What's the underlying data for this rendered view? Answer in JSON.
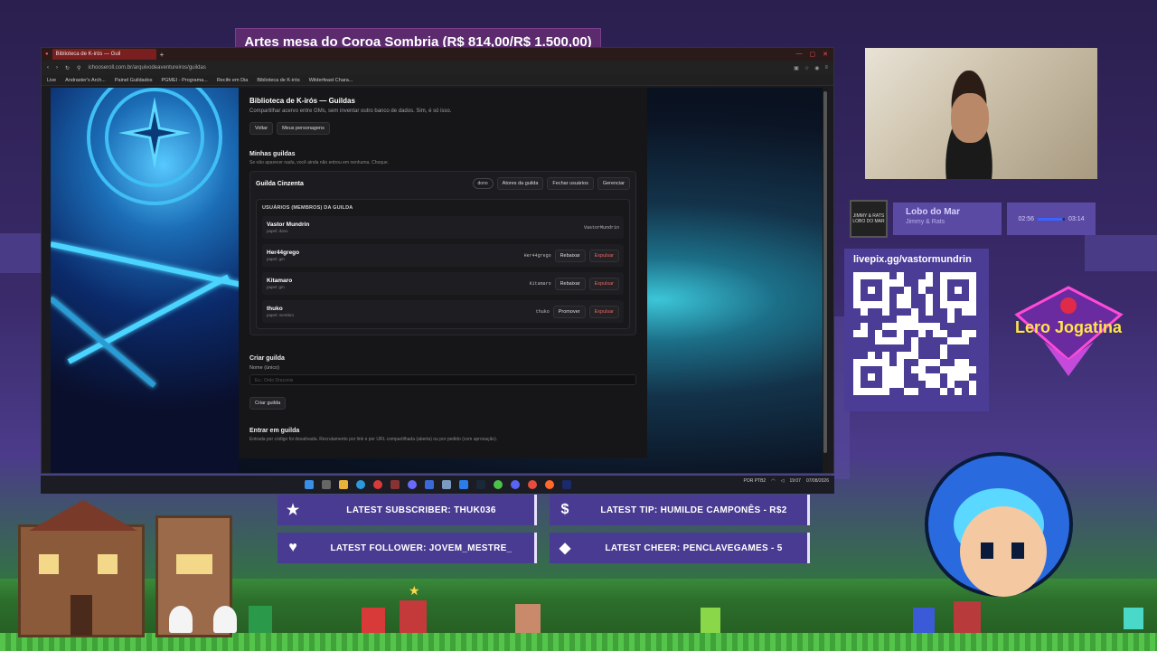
{
  "overlay": {
    "banner_title": "Artes mesa do Coroa Sombria (R$ 814,00/R$ 1.500,00)",
    "music": {
      "album_label": "JIMMY & RATS LOBO DO MAR",
      "title": "Lobo do Mar",
      "artist": "Jimmy & Rats",
      "elapsed": "02:56",
      "total": "03:14",
      "progress": 0.91
    },
    "pix_label": "livepix.gg/vastormundrin",
    "logo_text": "Lero Jogatina",
    "alerts": {
      "subscriber": "LATEST SUBSCRIBER: THUK036",
      "tip": "LATEST TIP: HUMILDE CAMPONÊS - R$2",
      "follower": "LATEST FOLLOWER: JOVEM_MESTRE_",
      "cheer": "LATEST CHEER: PENCLAVEGAMES - 5"
    },
    "colors": {
      "accent": "#4b3d96",
      "banner": "#5b2b6e",
      "danger": "#f06060"
    }
  },
  "browser": {
    "tab_title": "Biblioteca de K-irós — Guil",
    "url": "ichooseroll.com.br/arquivodeaventureiros/guildas",
    "bookmarks": [
      "Live",
      "Andraster's Arch...",
      "Painel Guildados",
      "PGMEI - Programa...",
      "Recife em Dia",
      "Biblioteca de K-irós",
      "Wilderfeast Chara..."
    ]
  },
  "app": {
    "title": "Biblioteca de K-irós — Guildas",
    "subtitle": "Compartilhar acervo entre GMs, sem inventar outro banco de dados. Sim, é só isso.",
    "back_button": "Voltar",
    "my_chars_button": "Meus personagens",
    "my_guilds": {
      "title": "Minhas guildas",
      "subtitle": "Se não aparecer nada, você ainda não entrou em nenhuma. Choque.",
      "guild": {
        "name": "Guilda Cinzenta",
        "role_badge": "dono",
        "actors_button": "Atores da guilda",
        "close_button": "Fechar usuários",
        "manage_button": "Gerenciar",
        "members_title": "USUÁRIOS (MEMBROS) DA GUILDA",
        "members": [
          {
            "name": "Vastor Mundrin",
            "role": "papel: dono",
            "handle": "VastorMundrin",
            "action": "",
            "kick": ""
          },
          {
            "name": "Her44grego",
            "role": "papel: gm",
            "handle": "Her44grego",
            "action": "Rebaixar",
            "kick": "Expulsar"
          },
          {
            "name": "Kitamaro",
            "role": "papel: gm",
            "handle": "Kitamaro",
            "action": "Rebaixar",
            "kick": "Expulsar"
          },
          {
            "name": "thuko",
            "role": "papel: membro",
            "handle": "thuko",
            "action": "Promover",
            "kick": "Expulsar"
          }
        ]
      }
    },
    "create": {
      "title": "Criar guilda",
      "label": "Nome (único)",
      "placeholder": "Ex.: Ordo Draconis",
      "button": "Criar guilda"
    },
    "join": {
      "title": "Entrar em guilda",
      "subtitle": "Entrada por código foi desativada. Recrutamento por link e por URL compartilhada (aberta) ou por pedido (com aprovação)."
    }
  },
  "taskbar": {
    "lang": "POR PTB2",
    "time": "19:07",
    "date": "07/08/2026"
  }
}
